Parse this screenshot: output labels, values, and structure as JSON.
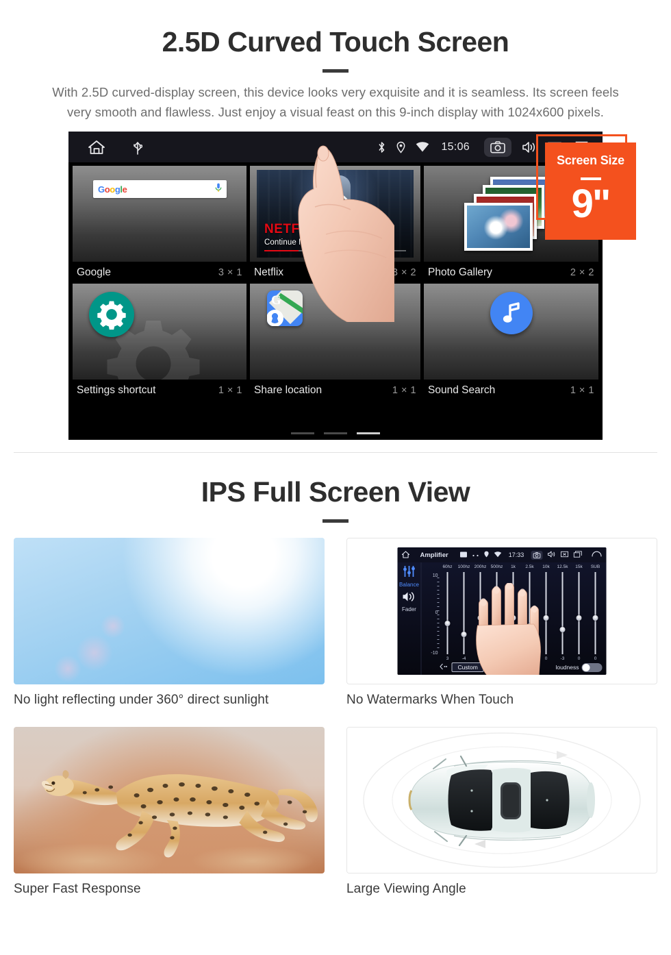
{
  "section1": {
    "title": "2.5D Curved Touch Screen",
    "subtitle": "With 2.5D curved-display screen, this device looks very exquisite and it is seamless. Its screen feels very smooth and flawless. Just enjoy a visual feast on this 9-inch display with 1024x600 pixels.",
    "badge": {
      "title": "Screen Size",
      "value": "9\"",
      "color": "#f4511e"
    },
    "device": {
      "statusbar": {
        "home_icon": "home-icon",
        "usb_icon": "usb-icon",
        "bluetooth_icon": "bluetooth-icon",
        "location_icon": "location-pin-icon",
        "wifi_icon": "wifi-icon",
        "time": "15:06",
        "camera_icon": "camera-icon",
        "volume_icon": "volume-icon",
        "close_icon": "close-box-icon",
        "recents_icon": "recent-apps-icon"
      },
      "widgets": [
        {
          "name": "Google",
          "size": "3 × 1",
          "icon": "google-search-bar-widget",
          "search_placeholder": "Google"
        },
        {
          "name": "Netflix",
          "size": "3 × 2",
          "icon": "netflix-widget",
          "brand": "NETFLIX",
          "caption": "Continue Marvel's Daredevil"
        },
        {
          "name": "Photo Gallery",
          "size": "2 × 2",
          "icon": "photo-gallery-widget"
        },
        {
          "name": "Settings shortcut",
          "size": "1 × 1",
          "icon": "gear-icon"
        },
        {
          "name": "Share location",
          "size": "1 × 1",
          "icon": "google-maps-icon"
        },
        {
          "name": "Sound Search",
          "size": "1 × 1",
          "icon": "music-note-icon"
        }
      ],
      "pager": {
        "count": 3,
        "active": 3
      }
    }
  },
  "section2": {
    "title": "IPS Full Screen View",
    "cards": [
      {
        "caption": "No light reflecting under 360° direct sunlight",
        "image": "sunlight-sky-photo"
      },
      {
        "caption": "No Watermarks When Touch",
        "image": "amplifier-equalizer-screen"
      },
      {
        "caption": "Super Fast Response",
        "image": "running-cheetah-photo"
      },
      {
        "caption": "Large Viewing Angle",
        "image": "car-top-view-illustration"
      }
    ],
    "amplifier": {
      "home_icon": "home-icon",
      "title": "Amplifier",
      "gallery_icon": "gallery-icon",
      "dots_icon": "more-dots-icon",
      "location_icon": "location-pin-icon",
      "wifi_icon": "wifi-icon",
      "time": "17:33",
      "camera_icon": "camera-icon",
      "volume_icon": "volume-icon",
      "close_icon": "close-box-icon",
      "recents_icon": "recent-apps-icon",
      "back_icon": "back-arrow-icon",
      "balance_label": "Balance",
      "fader_label": "Fader",
      "balance_icon": "sliders-icon",
      "fader_icon": "speaker-icon",
      "scale_top": "10",
      "scale_mid": "0",
      "scale_bottom": "-10",
      "bands": [
        "60hz",
        "100hz",
        "200hz",
        "500hz",
        "1k",
        "2.5k",
        "10k",
        "12.5k",
        "15k",
        "SUB"
      ],
      "values": [
        "3",
        "-4",
        "0",
        "0",
        "0",
        "-3",
        "0",
        "-3",
        "0",
        "0"
      ],
      "preset_label": "Custom",
      "loudness_label": "loudness",
      "loudness_on": false,
      "prev_icon": "chevron-left-icon"
    }
  }
}
